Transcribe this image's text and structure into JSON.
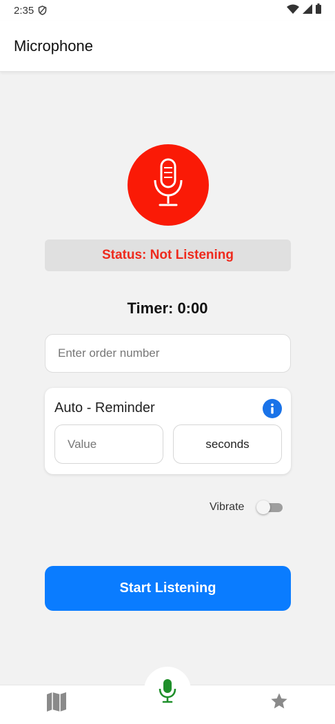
{
  "status_bar": {
    "time": "2:35"
  },
  "app_bar": {
    "title": "Microphone"
  },
  "status": {
    "text": "Status: Not Listening"
  },
  "timer": {
    "text": "Timer: 0:00"
  },
  "order": {
    "placeholder": "Enter order number"
  },
  "reminder": {
    "title": "Auto - Reminder",
    "value_placeholder": "Value",
    "unit": "seconds"
  },
  "vibrate": {
    "label": "Vibrate",
    "on": false
  },
  "start_button": {
    "label": "Start Listening"
  },
  "colors": {
    "mic_red": "#fa1a06",
    "status_red": "#ee2a1d",
    "primary_blue": "#0a7cff",
    "active_green": "#1f8f2a",
    "nav_grey": "#8a8a8a"
  },
  "icons": {
    "status_bar": [
      "shield-icon",
      "wifi-icon",
      "signal-icon",
      "battery-icon"
    ],
    "mic": "microphone-icon",
    "info": "info-icon",
    "nav": [
      "map-icon",
      "microphone-icon",
      "star-icon"
    ]
  }
}
